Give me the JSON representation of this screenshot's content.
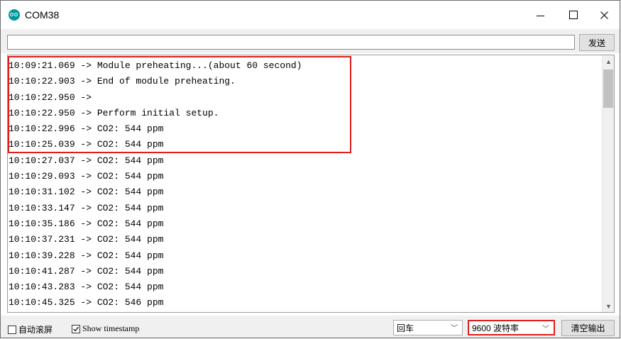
{
  "window": {
    "title": "COM38"
  },
  "send": {
    "input_value": "",
    "button_label": "发送"
  },
  "output": {
    "lines": [
      "10:09:21.069 -> Module preheating...(about 60 second)",
      "10:10:22.903 -> End of module preheating.",
      "10:10:22.950 -> ",
      "10:10:22.950 -> Perform initial setup.",
      "10:10:22.996 -> CO2: 544 ppm",
      "10:10:25.039 -> CO2: 544 ppm",
      "10:10:27.037 -> CO2: 544 ppm",
      "10:10:29.093 -> CO2: 544 ppm",
      "10:10:31.102 -> CO2: 544 ppm",
      "10:10:33.147 -> CO2: 544 ppm",
      "10:10:35.186 -> CO2: 544 ppm",
      "10:10:37.231 -> CO2: 544 ppm",
      "10:10:39.228 -> CO2: 544 ppm",
      "10:10:41.287 -> CO2: 544 ppm",
      "10:10:43.283 -> CO2: 544 ppm",
      "10:10:45.325 -> CO2: 546 ppm"
    ]
  },
  "bottom": {
    "autoscroll_label": "自动滚屏",
    "autoscroll_checked": false,
    "timestamp_label": "Show timestamp",
    "timestamp_checked": true,
    "line_ending_value": "回车",
    "baud_value": "9600 波特率",
    "clear_label": "清空输出"
  },
  "colors": {
    "highlight": "#e01e1e",
    "app_icon": "#00979c"
  }
}
